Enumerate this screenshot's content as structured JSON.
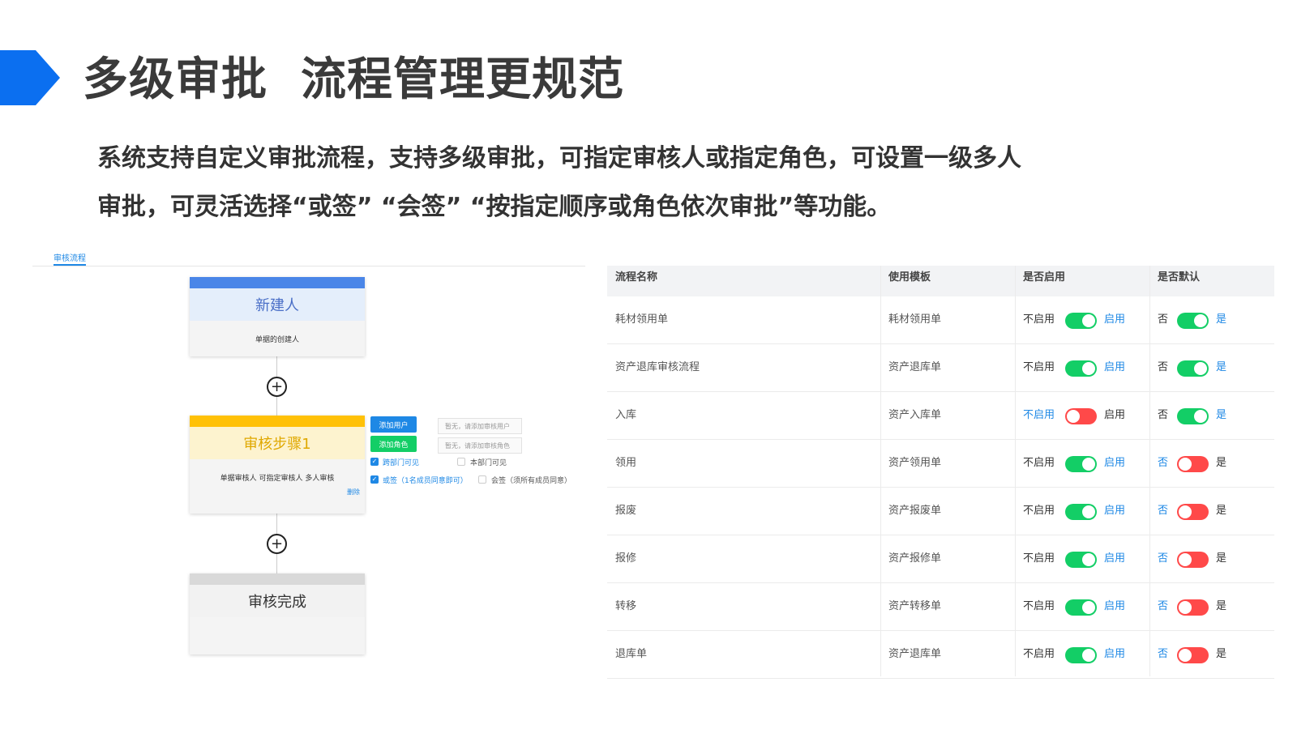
{
  "header": {
    "title": "多级审批  流程管理更规范",
    "desc_line1": "系统支持自定义审批流程，支持多级审批，可指定审核人或指定角色，可设置一级多人",
    "desc_line2": "审批，可灵活选择“或签” “会签” “按指定顺序或角色依次审批”等功能。"
  },
  "colors": {
    "accent": "#0b6ff0",
    "active_blue": "#1e88e5",
    "switch_on": "#13ce66",
    "switch_off": "#ff4949"
  },
  "flow": {
    "tab_label": "审核流程",
    "card_creator": {
      "title": "新建人",
      "body": "单据的创建人"
    },
    "card_step": {
      "title": "审核步骤1",
      "body": "单据审核人 可指定审核人 多人审核",
      "delete_link": "删除"
    },
    "card_done": {
      "title": "审核完成"
    },
    "add_user_button": "添加用户",
    "add_role_button": "添加角色",
    "empty_user_text": "暂无，请添加审核用户",
    "empty_role_text": "暂无，请添加审核角色",
    "option_cross_dept": "跨部门可见",
    "option_own_dept": "本部门可见",
    "option_or_sign": "或签（1名成员同意即可）",
    "option_co_sign": "会签（须所有成员同意）",
    "plus_symbol": "+"
  },
  "table": {
    "headers": [
      "流程名称",
      "使用模板",
      "是否启用",
      "是否默认"
    ],
    "label_disable": "不启用",
    "label_enable": "启用",
    "label_no": "否",
    "label_yes": "是",
    "rows": [
      {
        "name": "耗材领用单",
        "template": "耗材领用单",
        "enabled": true,
        "default": true
      },
      {
        "name": "资产退库审核流程",
        "template": "资产退库单",
        "enabled": true,
        "default": true
      },
      {
        "name": "入库",
        "template": "资产入库单",
        "enabled": false,
        "default": true
      },
      {
        "name": "领用",
        "template": "资产领用单",
        "enabled": true,
        "default": false
      },
      {
        "name": "报废",
        "template": "资产报废单",
        "enabled": true,
        "default": false
      },
      {
        "name": "报修",
        "template": "资产报修单",
        "enabled": true,
        "default": false
      },
      {
        "name": "转移",
        "template": "资产转移单",
        "enabled": true,
        "default": false
      },
      {
        "name": "退库单",
        "template": "资产退库单",
        "enabled": true,
        "default": false
      }
    ]
  }
}
